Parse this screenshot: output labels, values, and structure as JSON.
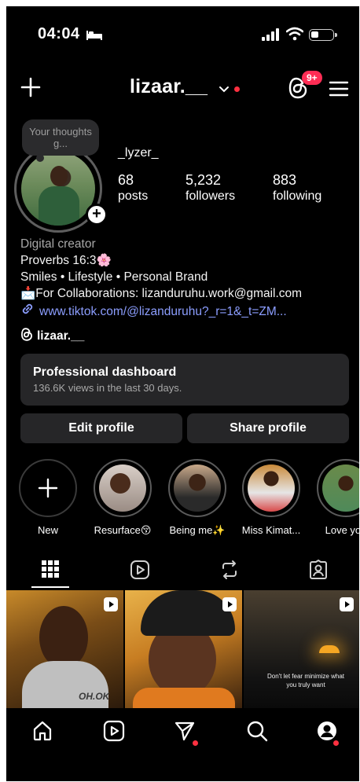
{
  "status_bar": {
    "time": "04:04"
  },
  "header": {
    "username": "lizaar.__",
    "notification_badge": "9+"
  },
  "profile": {
    "note": "Your thoughts g...",
    "display_name": "_lyzer_",
    "stats": [
      {
        "value": "68",
        "label": "posts"
      },
      {
        "value": "5,232",
        "label": "followers"
      },
      {
        "value": "883",
        "label": "following"
      }
    ],
    "category": "Digital creator",
    "bio_lines": [
      "Proverbs 16:3🌸",
      "Smiles • Lifestyle • Personal Brand",
      "📩For Collaborations: lizanduruhu.work@gmail.com"
    ],
    "link": "www.tiktok.com/@lizanduruhu?_r=1&_t=ZM...",
    "threads_handle": "lizaar.__"
  },
  "dashboard": {
    "title": "Professional dashboard",
    "subtitle": "136.6K views in the last 30 days."
  },
  "buttons": {
    "edit": "Edit profile",
    "share": "Share profile"
  },
  "highlights": [
    {
      "label": "New"
    },
    {
      "label": "Resurface😚"
    },
    {
      "label": "Being me✨"
    },
    {
      "label": "Miss Kimat..."
    },
    {
      "label": "Love you"
    }
  ],
  "grid": {
    "post1_text": "OH.OK",
    "post3_text": "Don't let fear minimize what you truly want"
  },
  "colors": {
    "accent_red": "#ff3040",
    "link_blue": "#8c9eff",
    "surface": "#262628"
  }
}
